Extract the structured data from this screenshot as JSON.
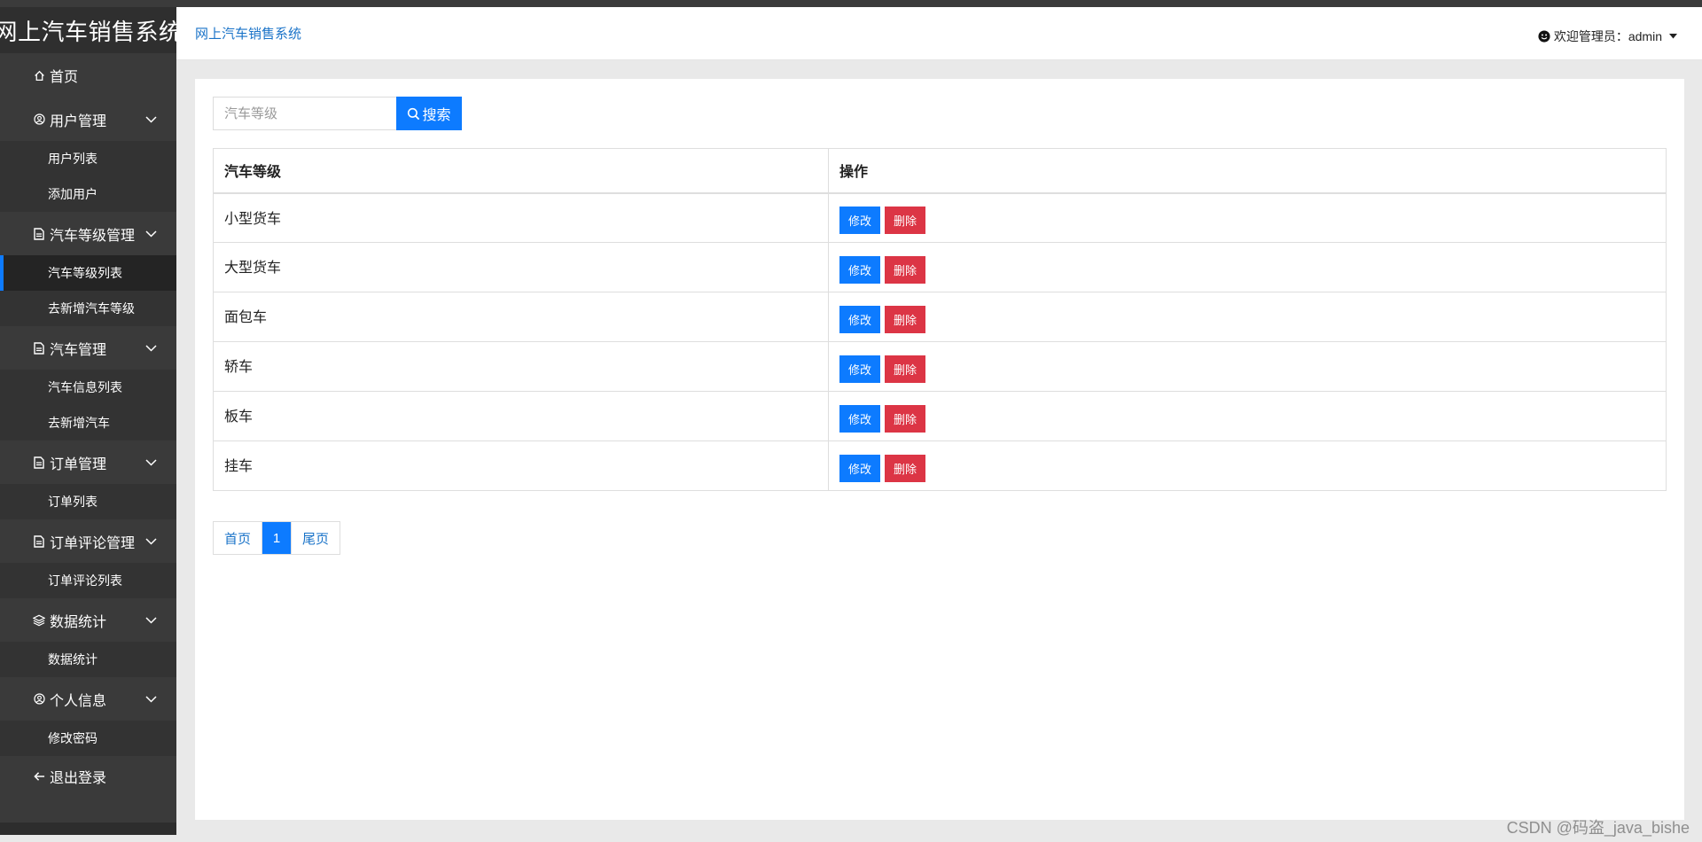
{
  "app": {
    "brand": "网上汽车销售系统",
    "header_title": "网上汽车销售系统",
    "user_label": "欢迎管理员：admin"
  },
  "sidebar": {
    "home": {
      "label": "首页",
      "icon": "home-icon"
    },
    "groups": [
      {
        "label": "用户管理",
        "icon": "user-circle-icon",
        "subs": [
          "用户列表",
          "添加用户"
        ]
      },
      {
        "label": "汽车等级管理",
        "icon": "document-icon",
        "subs": [
          "汽车等级列表",
          "去新增汽车等级"
        ],
        "active_sub": 0
      },
      {
        "label": "汽车管理",
        "icon": "document-icon",
        "subs": [
          "汽车信息列表",
          "去新增汽车"
        ]
      },
      {
        "label": "订单管理",
        "icon": "document-icon",
        "subs": [
          "订单列表"
        ]
      },
      {
        "label": "订单评论管理",
        "icon": "document-icon",
        "subs": [
          "订单评论列表"
        ]
      },
      {
        "label": "数据统计",
        "icon": "layers-icon",
        "subs": [
          "数据统计"
        ]
      },
      {
        "label": "个人信息",
        "icon": "user-circle-icon",
        "subs": [
          "修改密码"
        ]
      }
    ],
    "logout": {
      "label": "退出登录",
      "icon": "arrow-left-icon"
    }
  },
  "search": {
    "placeholder": "汽车等级",
    "value": "",
    "button_label": "搜索"
  },
  "table": {
    "headers": [
      "汽车等级",
      "操作"
    ],
    "rows": [
      "小型货车",
      "大型货车",
      "面包车",
      "轿车",
      "板车",
      "挂车"
    ],
    "edit_label": "修改",
    "delete_label": "删除"
  },
  "pagination": {
    "first": "首页",
    "current": "1",
    "last": "尾页"
  },
  "watermark": "CSDN @码盗_java_bishe",
  "colors": {
    "primary": "#0d7bff",
    "danger": "#dc3545",
    "sidebar_bg": "#3a3a3a",
    "link": "#1a73c8"
  }
}
